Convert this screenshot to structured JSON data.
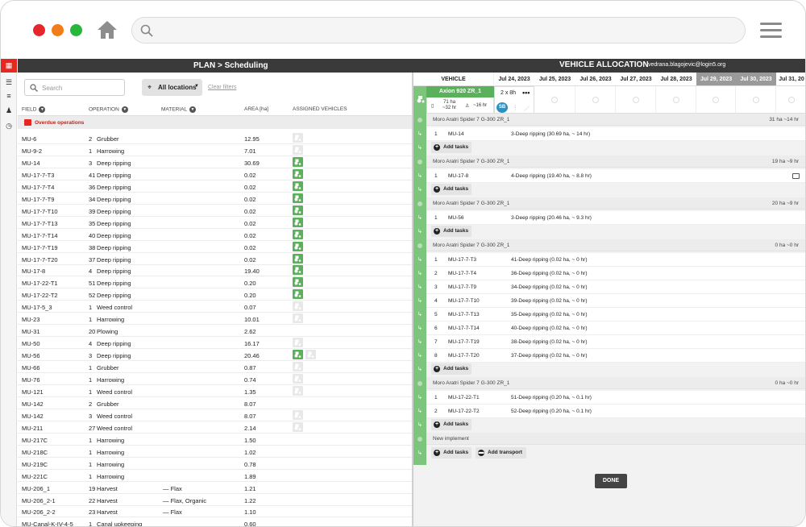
{
  "header": {
    "title": "PLAN",
    "breadcrumb_sep": ">",
    "section": "Scheduling",
    "right_title": "VEHICLE ALLOCATION",
    "user_email": "vedrana.blagojevic@login5.org"
  },
  "filters": {
    "search_placeholder": "Search",
    "locations_label": "All locations",
    "clear_label": "Clear filters"
  },
  "columns": {
    "field": "FIELD",
    "operation": "OPERATION",
    "material": "MATERIAL",
    "area": "AREA [ha]",
    "vehicles": "ASSIGNED VEHICLES"
  },
  "overdue_label": "Overdue operations",
  "rows": [
    {
      "field": "MU-6",
      "num": "2",
      "op": "Grubber",
      "mat": "",
      "area": "12.95",
      "veh": [
        "off"
      ]
    },
    {
      "field": "MU-9-2",
      "num": "1",
      "op": "Harrowing",
      "mat": "",
      "area": "7.01",
      "veh": [
        "off"
      ]
    },
    {
      "field": "MU-14",
      "num": "3",
      "op": "Deep ripping",
      "mat": "",
      "area": "30.69",
      "veh": [
        "on"
      ]
    },
    {
      "field": "MU-17-7-T3",
      "num": "41",
      "op": "Deep ripping",
      "mat": "",
      "area": "0.02",
      "veh": [
        "on"
      ]
    },
    {
      "field": "MU-17-7-T4",
      "num": "36",
      "op": "Deep ripping",
      "mat": "",
      "area": "0.02",
      "veh": [
        "on"
      ]
    },
    {
      "field": "MU-17-7-T9",
      "num": "34",
      "op": "Deep ripping",
      "mat": "",
      "area": "0.02",
      "veh": [
        "on"
      ]
    },
    {
      "field": "MU-17-7-T10",
      "num": "39",
      "op": "Deep ripping",
      "mat": "",
      "area": "0.02",
      "veh": [
        "on"
      ]
    },
    {
      "field": "MU-17-7-T13",
      "num": "35",
      "op": "Deep ripping",
      "mat": "",
      "area": "0.02",
      "veh": [
        "on"
      ]
    },
    {
      "field": "MU-17-7-T14",
      "num": "40",
      "op": "Deep ripping",
      "mat": "",
      "area": "0.02",
      "veh": [
        "on"
      ]
    },
    {
      "field": "MU-17-7-T19",
      "num": "38",
      "op": "Deep ripping",
      "mat": "",
      "area": "0.02",
      "veh": [
        "on"
      ]
    },
    {
      "field": "MU-17-7-T20",
      "num": "37",
      "op": "Deep ripping",
      "mat": "",
      "area": "0.02",
      "veh": [
        "on"
      ]
    },
    {
      "field": "MU-17-8",
      "num": "4",
      "op": "Deep ripping",
      "mat": "",
      "area": "19.40",
      "veh": [
        "on"
      ]
    },
    {
      "field": "MU-17-22-T1",
      "num": "51",
      "op": "Deep ripping",
      "mat": "",
      "area": "0.20",
      "veh": [
        "on"
      ]
    },
    {
      "field": "MU-17-22-T2",
      "num": "52",
      "op": "Deep ripping",
      "mat": "",
      "area": "0.20",
      "veh": [
        "on"
      ]
    },
    {
      "field": "MU-17-5_3",
      "num": "1",
      "op": "Weed control",
      "mat": "",
      "area": "0.07",
      "veh": [
        "off"
      ]
    },
    {
      "field": "MU-23",
      "num": "1",
      "op": "Harrowing",
      "mat": "",
      "area": "10.01",
      "veh": [
        "off"
      ]
    },
    {
      "field": "MU-31",
      "num": "20",
      "op": "Plowing",
      "mat": "",
      "area": "2.62",
      "veh": []
    },
    {
      "field": "MU-50",
      "num": "4",
      "op": "Deep ripping",
      "mat": "",
      "area": "16.17",
      "veh": [
        "off"
      ]
    },
    {
      "field": "MU-56",
      "num": "3",
      "op": "Deep ripping",
      "mat": "",
      "area": "20.46",
      "veh": [
        "on",
        "off"
      ]
    },
    {
      "field": "MU-66",
      "num": "1",
      "op": "Grubber",
      "mat": "",
      "area": "0.87",
      "veh": [
        "off"
      ]
    },
    {
      "field": "MU-76",
      "num": "1",
      "op": "Harrowing",
      "mat": "",
      "area": "0.74",
      "veh": [
        "off"
      ]
    },
    {
      "field": "MU-121",
      "num": "1",
      "op": "Weed control",
      "mat": "",
      "area": "1.35",
      "veh": [
        "off"
      ]
    },
    {
      "field": "MU-142",
      "num": "2",
      "op": "Grubber",
      "mat": "",
      "area": "8.07",
      "veh": []
    },
    {
      "field": "MU-142",
      "num": "3",
      "op": "Weed control",
      "mat": "",
      "area": "8.07",
      "veh": [
        "off"
      ]
    },
    {
      "field": "MU-211",
      "num": "27",
      "op": "Weed control",
      "mat": "",
      "area": "2.14",
      "veh": [
        "off"
      ]
    },
    {
      "field": "MU-217C",
      "num": "1",
      "op": "Harrowing",
      "mat": "",
      "area": "1.50",
      "veh": []
    },
    {
      "field": "MU-218C",
      "num": "1",
      "op": "Harrowing",
      "mat": "",
      "area": "1.02",
      "veh": []
    },
    {
      "field": "MU-219C",
      "num": "1",
      "op": "Harrowing",
      "mat": "",
      "area": "0.78",
      "veh": []
    },
    {
      "field": "MU-221C",
      "num": "1",
      "op": "Harrowing",
      "mat": "",
      "area": "1.89",
      "veh": []
    },
    {
      "field": "MU-206_1",
      "num": "19",
      "op": "Harvest",
      "mat": "— Flax",
      "area": "1.21",
      "veh": []
    },
    {
      "field": "MU-206_2-1",
      "num": "22",
      "op": "Harvest",
      "mat": "— Flax, Organic",
      "area": "1.22",
      "veh": []
    },
    {
      "field": "MU-206_2-2",
      "num": "23",
      "op": "Harvest",
      "mat": "— Flax",
      "area": "1.10",
      "veh": []
    },
    {
      "field": "MU-Canal-K-IV-4-5",
      "num": "1",
      "op": "Canal upkeeping",
      "mat": "",
      "area": "0.60",
      "veh": []
    }
  ],
  "allocation": {
    "vehicle_header": "VEHICLE",
    "dates": [
      {
        "label": "Jul 24, 2023",
        "weekend": false
      },
      {
        "label": "Jul 25, 2023",
        "weekend": false
      },
      {
        "label": "Jul 26, 2023",
        "weekend": false
      },
      {
        "label": "Jul 27, 2023",
        "weekend": false
      },
      {
        "label": "Jul 28, 2023",
        "weekend": false
      },
      {
        "label": "Jul 29, 2023",
        "weekend": true
      },
      {
        "label": "Jul 30, 2023",
        "weekend": true
      },
      {
        "label": "Jul 31, 20",
        "weekend": false
      }
    ],
    "vehicle": {
      "name": "Axion 920 ZR_1",
      "ha_top": "71 ha",
      "ha_bottom": "~32 hr",
      "persons": "~16 hr",
      "shift": "2 x 8h",
      "more": "•••",
      "avatar": "SB"
    },
    "groups": [
      {
        "name": "Moro Aratri Spider 7 G-300 ZR_1",
        "hours": "31 ha ~14 hr",
        "tasks": [
          {
            "n": "1",
            "field": "MU-14",
            "op": "3-Deep ripping (30.69 ha, ~ 14 hr)"
          }
        ],
        "comment": false
      },
      {
        "name": "Moro Aratri Spider 7 G-300 ZR_1",
        "hours": "19 ha ~9 hr",
        "tasks": [
          {
            "n": "1",
            "field": "MU-17-8",
            "op": "4-Deep ripping (19.40 ha, ~ 8.8 hr)"
          }
        ],
        "comment": true
      },
      {
        "name": "Moro Aratri Spider 7 G-300 ZR_1",
        "hours": "20 ha ~9 hr",
        "tasks": [
          {
            "n": "1",
            "field": "MU-56",
            "op": "3-Deep ripping (20.46 ha, ~ 9.3 hr)"
          }
        ],
        "comment": false
      },
      {
        "name": "Moro Aratri Spider 7 G-300 ZR_1",
        "hours": "0 ha ~0 hr",
        "tasks": [
          {
            "n": "1",
            "field": "MU-17-7-T3",
            "op": "41-Deep ripping (0.02 ha, ~ 0 hr)"
          },
          {
            "n": "2",
            "field": "MU-17-7-T4",
            "op": "36-Deep ripping (0.02 ha, ~ 0 hr)"
          },
          {
            "n": "3",
            "field": "MU-17-7-T9",
            "op": "34-Deep ripping (0.02 ha, ~ 0 hr)"
          },
          {
            "n": "4",
            "field": "MU-17-7-T10",
            "op": "39-Deep ripping (0.02 ha, ~ 0 hr)"
          },
          {
            "n": "5",
            "field": "MU-17-7-T13",
            "op": "35-Deep ripping (0.02 ha, ~ 0 hr)"
          },
          {
            "n": "6",
            "field": "MU-17-7-T14",
            "op": "40-Deep ripping (0.02 ha, ~ 0 hr)"
          },
          {
            "n": "7",
            "field": "MU-17-7-T19",
            "op": "38-Deep ripping (0.02 ha, ~ 0 hr)"
          },
          {
            "n": "8",
            "field": "MU-17-7-T20",
            "op": "37-Deep ripping (0.02 ha, ~ 0 hr)"
          }
        ],
        "comment": false
      },
      {
        "name": "Moro Aratri Spider 7 G-300 ZR_1",
        "hours": "0 ha ~0 hr",
        "tasks": [
          {
            "n": "1",
            "field": "MU-17-22-T1",
            "op": "51-Deep ripping (0.20 ha, ~ 0.1 hr)"
          },
          {
            "n": "2",
            "field": "MU-17-22-T2",
            "op": "52-Deep ripping (0.20 ha, ~ 0.1 hr)"
          }
        ],
        "comment": false
      }
    ],
    "new_implement": "New implement",
    "add_tasks": "Add tasks",
    "add_transport": "Add transport",
    "done": "DONE"
  },
  "colors": {
    "accent": "#e6261f",
    "vehicle_green": "#5bb15b",
    "topbar": "#3a3a3a"
  }
}
